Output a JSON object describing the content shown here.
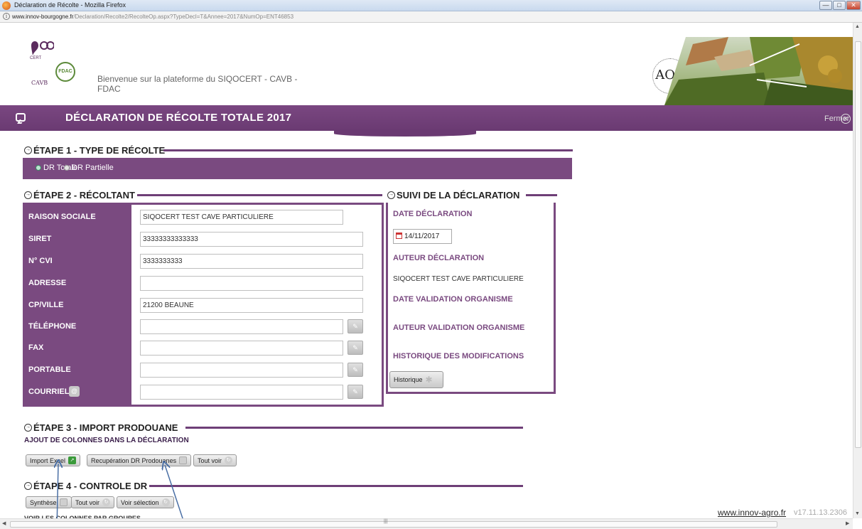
{
  "window": {
    "title": "Déclaration de Récolte - Mozilla Firefox",
    "url_host": "www.innov-bourgogne.fr",
    "url_path": "/Declaration/Recolte2/RecolteOp.aspx?TypeDecl=T&Annee=2017&NumOp=ENT46853"
  },
  "header": {
    "welcome_line1": "Bienvenue sur la plateforme du SIQOCERT - CAVB -",
    "welcome_line2": "FDAC",
    "logo_fdac": "FDAC",
    "logo_cavb": "CAVB",
    "logo_aoc": "AOC"
  },
  "band": {
    "title": "DÉCLARATION DE RÉCOLTE TOTALE 2017",
    "close_label": "Fermer"
  },
  "step1": {
    "title": "ÉTAPE 1 - TYPE DE RÉCOLTE",
    "options": [
      "DR Totale",
      "DR Partielle"
    ],
    "selected": "DR Totale"
  },
  "step2": {
    "title": "ÉTAPE 2 - RÉCOLTANT",
    "fields": [
      {
        "label": "RAISON SOCIALE",
        "value": "SIQOCERT TEST CAVE PARTICULIERE"
      },
      {
        "label": "SIRET",
        "value": "33333333333333"
      },
      {
        "label": "N° CVI",
        "value": "3333333333"
      },
      {
        "label": "ADRESSE",
        "value": ""
      },
      {
        "label": "CP/VILLE",
        "value": "21200 BEAUNE"
      },
      {
        "label": "TÉLÉPHONE",
        "value": ""
      },
      {
        "label": "FAX",
        "value": ""
      },
      {
        "label": "PORTABLE",
        "value": ""
      },
      {
        "label": "COURRIEL",
        "value": ""
      }
    ]
  },
  "suivi": {
    "title": "SUIVI DE LA DÉCLARATION",
    "date_label": "DATE DÉCLARATION",
    "date_value": "14/11/2017",
    "auteur_label": "AUTEUR DÉCLARATION",
    "auteur_value": "SIQOCERT TEST CAVE PARTICULIERE",
    "date_validation_label": "DATE VALIDATION ORGANISME",
    "auteur_validation_label": "AUTEUR VALIDATION ORGANISME",
    "historique_label": "HISTORIQUE DES MODIFICATIONS",
    "historique_button": "Historique"
  },
  "step3": {
    "title": "ÉTAPE 3 - IMPORT PRODOUANE",
    "subtitle": "AJOUT DE COLONNES DANS LA DÉCLARATION",
    "buttons": [
      "Import Excel",
      "Recupération DR Prodouanes",
      "Tout voir"
    ]
  },
  "step4": {
    "title": "ÉTAPE 4 - CONTROLE DR",
    "buttons": [
      "Synthèse",
      "Tout voir",
      "Voir sélection"
    ],
    "cut_text": "VOIR LES COLONNES PAR GROUPES"
  },
  "footer": {
    "link": "www.innov-agro.fr",
    "version": "v17.11.13.2306"
  },
  "colors": {
    "purple": "#7a4a80",
    "band": "#6a3a72",
    "annotation_arrow": "#4a6fa5"
  }
}
